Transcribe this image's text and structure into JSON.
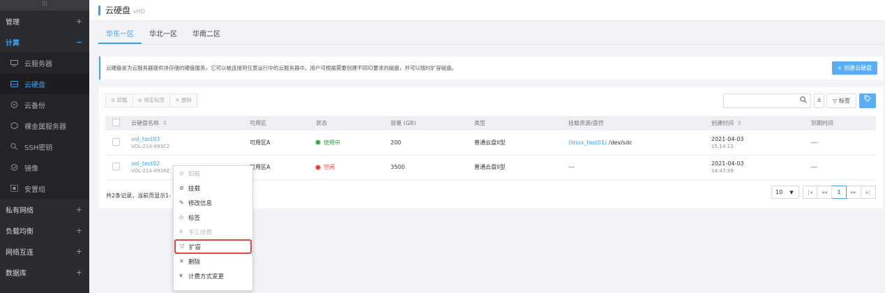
{
  "sidebar": {
    "grip": "|||",
    "groups": [
      {
        "label": "管理",
        "toggle": "+"
      },
      {
        "label": "计算",
        "toggle": "−"
      }
    ],
    "items": [
      {
        "label": "云服务器",
        "icon": "monitor-icon"
      },
      {
        "label": "云硬盘",
        "icon": "disk-icon"
      },
      {
        "label": "云备份",
        "icon": "backup-icon"
      },
      {
        "label": "裸金属服务器",
        "icon": "cube-icon"
      },
      {
        "label": "SSH密钥",
        "icon": "key-icon"
      },
      {
        "label": "镜像",
        "icon": "image-icon"
      },
      {
        "label": "安置组",
        "icon": "group-icon"
      }
    ],
    "groups_after": [
      {
        "label": "私有网络",
        "toggle": "+"
      },
      {
        "label": "负载均衡",
        "toggle": "+"
      },
      {
        "label": "网络互连",
        "toggle": "+"
      },
      {
        "label": "数据库",
        "toggle": "+"
      }
    ]
  },
  "header": {
    "title": "云硬盘",
    "subtitle": "vHD"
  },
  "tabs": [
    {
      "label": "华东一区"
    },
    {
      "label": "华北一区"
    },
    {
      "label": "华南二区"
    }
  ],
  "info": {
    "text": "云硬盘是为云服务器提供块存储的硬盘服务，它可以被连接到任意运行中的云服务器中。用户可根据需要创建不同IO要求的磁盘，并可以随时扩容磁盘。",
    "create_label": "+ 创建云硬盘"
  },
  "toolbar": {
    "unmount": "⊘ 卸载",
    "bind_tag": "⊘ 绑定标签",
    "delete": "✕ 删除",
    "tag_filter": "▽ 标签",
    "collapse": "≚"
  },
  "table": {
    "headers": [
      "云硬盘名称",
      "可用区",
      "状态",
      "容量 (GB)",
      "类型",
      "挂载资源/盘符",
      "创建时间",
      "到期时间"
    ],
    "rows": [
      {
        "name": "vol_test03",
        "id": "VOL-21A-093C2",
        "zone": "可用区A",
        "status": "使用中",
        "capacity": "200",
        "type": "普通云盘II型",
        "mount_link": "(linux_test01)",
        "mount_disk": " /dev/sdc",
        "created_date": "2021-04-03",
        "created_time": "15:14:13",
        "expire": "---"
      },
      {
        "name": "vol_test02",
        "id": "VOL-21A-0938Z",
        "zone": "可用区A",
        "status": "空闲",
        "capacity": "3500",
        "type": "普通云盘II型",
        "mount_link": "",
        "mount_disk": "---",
        "created_date": "2021-04-03",
        "created_time": "14:47:39",
        "expire": "---"
      }
    ]
  },
  "footer": {
    "summary": "共2条记录，当前页显示1-",
    "page_size": "10",
    "current_page": "1"
  },
  "context_menu": {
    "items": [
      {
        "icon": "⊘",
        "label": "卸载",
        "disabled": true
      },
      {
        "icon": "⊘",
        "label": "挂载",
        "disabled": false
      },
      {
        "icon": "✎",
        "label": "修改信息",
        "disabled": false
      },
      {
        "icon": "◇",
        "label": "标签",
        "disabled": false
      },
      {
        "icon": "¥",
        "label": "手工续费",
        "disabled": true
      },
      {
        "icon": "⤧",
        "label": "扩容",
        "disabled": false,
        "highlight": true
      },
      {
        "icon": "✕",
        "label": "删除",
        "disabled": false
      },
      {
        "icon": "¥",
        "label": "计费方式变更",
        "disabled": false
      }
    ]
  },
  "colors": {
    "accent": "#3aa0f3",
    "sidebar_bg": "#2b2c30",
    "status_in_use": "#2ea24a",
    "status_idle": "#e33333",
    "highlight_border": "#e0463b"
  }
}
